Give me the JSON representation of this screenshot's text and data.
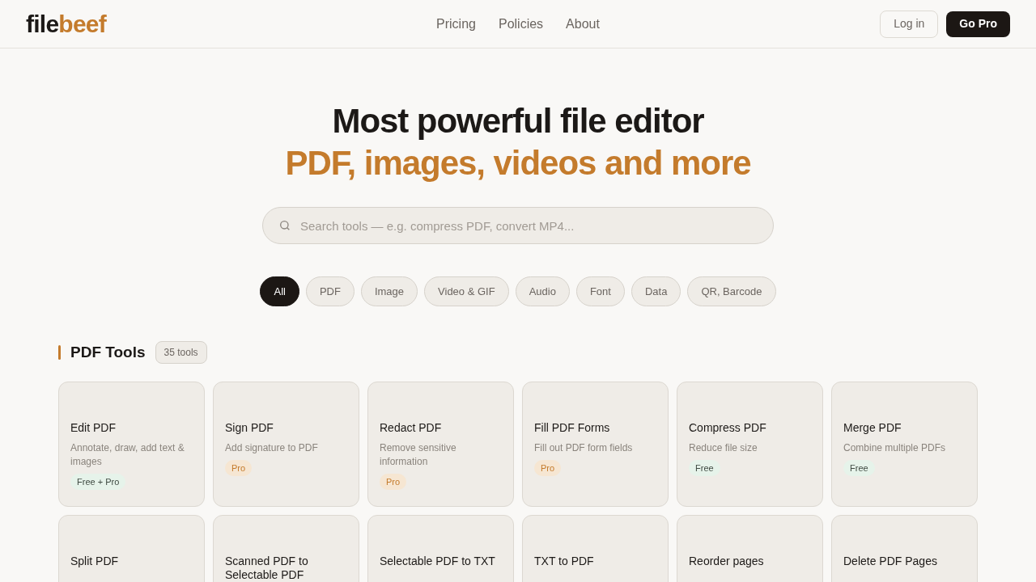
{
  "logo": {
    "part1": "file",
    "part2": "beef"
  },
  "nav": [
    "Pricing",
    "Policies",
    "About"
  ],
  "login": "Log in",
  "go_pro": "Go Pro",
  "hero": {
    "title": "Most powerful file editor",
    "subtitle": "PDF, images, videos and more"
  },
  "search": {
    "placeholder": "Search tools — e.g. compress PDF, convert MP4..."
  },
  "filters": [
    {
      "label": "All",
      "selected": true
    },
    {
      "label": "PDF",
      "selected": false
    },
    {
      "label": "Image",
      "selected": false
    },
    {
      "label": "Video & GIF",
      "selected": false
    },
    {
      "label": "Audio",
      "selected": false
    },
    {
      "label": "Font",
      "selected": false
    },
    {
      "label": "Data",
      "selected": false
    },
    {
      "label": "QR, Barcode",
      "selected": false
    }
  ],
  "section": {
    "title": "PDF Tools",
    "count": "35 tools"
  },
  "tools": [
    {
      "title": "Edit PDF",
      "description": "Annotate, draw, add text & images",
      "badge": {
        "label": "Free + Pro",
        "kind": "free"
      }
    },
    {
      "title": "Sign PDF",
      "description": "Add signature to PDF",
      "badge": {
        "label": "Pro",
        "kind": "pro"
      }
    },
    {
      "title": "Redact PDF",
      "description": "Remove sensitive information",
      "badge": {
        "label": "Pro",
        "kind": "pro"
      }
    },
    {
      "title": "Fill PDF Forms",
      "description": "Fill out PDF form fields",
      "badge": {
        "label": "Pro",
        "kind": "pro"
      }
    },
    {
      "title": "Compress PDF",
      "description": "Reduce file size",
      "badge": {
        "label": "Free",
        "kind": "free"
      }
    },
    {
      "title": "Merge PDF",
      "description": "Combine multiple PDFs",
      "badge": {
        "label": "Free",
        "kind": "free"
      }
    },
    {
      "title": "Split PDF"
    },
    {
      "title": "Scanned PDF to Selectable PDF"
    },
    {
      "title": "Selectable PDF to TXT"
    },
    {
      "title": "TXT to PDF"
    },
    {
      "title": "Reorder pages"
    },
    {
      "title": "Delete PDF Pages"
    }
  ]
}
